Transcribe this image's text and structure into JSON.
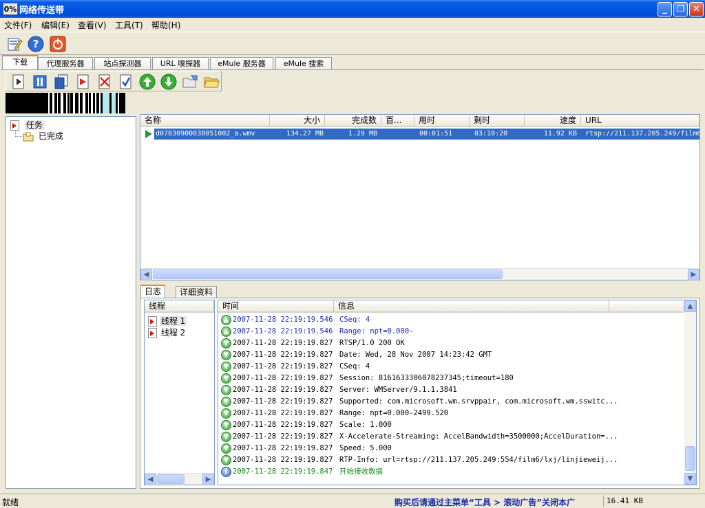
{
  "window": {
    "icon_text": "0%",
    "title": "网络传送带",
    "minimize_glyph": "_",
    "maximize_glyph": "❐",
    "close_glyph": "✕"
  },
  "menu": [
    "文件(F)",
    "编辑(E)",
    "查看(V)",
    "工具(T)",
    "帮助(H)"
  ],
  "toolbar": [
    "new-task-icon",
    "help-icon",
    "power-icon"
  ],
  "tabs": [
    "下载",
    "代理服务器",
    "站点探测器",
    "URL 嗅探器",
    "eMule 服务器",
    "eMule 搜索"
  ],
  "download_toolbar": [
    "start-icon",
    "pause-icon",
    "stop-icon",
    "open-icon",
    "delete-icon",
    "check-icon",
    "move-up-icon",
    "move-down-icon",
    "open-folder-icon",
    "folder-icon"
  ],
  "tree": {
    "root": "任务",
    "child": "已完成"
  },
  "task_list": {
    "columns": [
      "名称",
      "大小",
      "完成数",
      "百...",
      "用时",
      "剩时",
      "速度",
      "URL"
    ],
    "rows": [
      {
        "name": "d07030900030051002_a.wmv",
        "size": "134.27 MB",
        "done": "1.29 MB",
        "percent": "",
        "elapsed": "00:01:51",
        "remaining": "03:10:20",
        "speed": "11.92 KB",
        "url": "rtsp://211.137.205.249/film6"
      }
    ]
  },
  "log_tabs": [
    "日志",
    "详细资料"
  ],
  "threads": {
    "header": "线程",
    "items": [
      "线程 1",
      "线程 2"
    ]
  },
  "log": {
    "headers": [
      "时间",
      "信息"
    ],
    "rows": [
      {
        "type": "up",
        "time": "2007-11-28 22:19:19.546",
        "msg": "CSeq: 4",
        "color": "#1c2ba8"
      },
      {
        "type": "up",
        "time": "2007-11-28 22:19:19.546",
        "msg": "Range: npt=0.000-",
        "color": "#1c2ba8"
      },
      {
        "type": "down",
        "time": "2007-11-28 22:19:19.827",
        "msg": "RTSP/1.0 200 OK",
        "color": "#000000"
      },
      {
        "type": "down",
        "time": "2007-11-28 22:19:19.827",
        "msg": "Date: Wed, 28 Nov 2007 14:23:42 GMT",
        "color": "#000000"
      },
      {
        "type": "down",
        "time": "2007-11-28 22:19:19.827",
        "msg": "CSeq: 4",
        "color": "#000000"
      },
      {
        "type": "down",
        "time": "2007-11-28 22:19:19.827",
        "msg": "Session: 8161633306078237345;timeout=180",
        "color": "#000000"
      },
      {
        "type": "down",
        "time": "2007-11-28 22:19:19.827",
        "msg": "Server: WMServer/9.1.1.3841",
        "color": "#000000"
      },
      {
        "type": "down",
        "time": "2007-11-28 22:19:19.827",
        "msg": "Supported: com.microsoft.wm.srvppair, com.microsoft.wm.sswitc...",
        "color": "#000000"
      },
      {
        "type": "down",
        "time": "2007-11-28 22:19:19.827",
        "msg": "Range: npt=0.000-2499.520",
        "color": "#000000"
      },
      {
        "type": "down",
        "time": "2007-11-28 22:19:19.827",
        "msg": "Scale: 1.000",
        "color": "#000000"
      },
      {
        "type": "down",
        "time": "2007-11-28 22:19:19.827",
        "msg": "X-Accelerate-Streaming: AccelBandwidth=3500000;AccelDuration=...",
        "color": "#000000"
      },
      {
        "type": "down",
        "time": "2007-11-28 22:19:19.827",
        "msg": "Speed: 5.000",
        "color": "#000000"
      },
      {
        "type": "down",
        "time": "2007-11-28 22:19:19.827",
        "msg": "RTP-Info: url=rtsp://211.137.205.249:554/film6/lxj/linjieweij...",
        "color": "#000000"
      },
      {
        "type": "info",
        "time": "2007-11-28 22:19:19.847",
        "msg": "开始接收数据",
        "color": "#138a13"
      }
    ]
  },
  "status": {
    "left": "就绪",
    "ad": "购买后请通过主菜单“工具 > 滚动广告”关闭本广",
    "speed": "16.41 KB"
  }
}
